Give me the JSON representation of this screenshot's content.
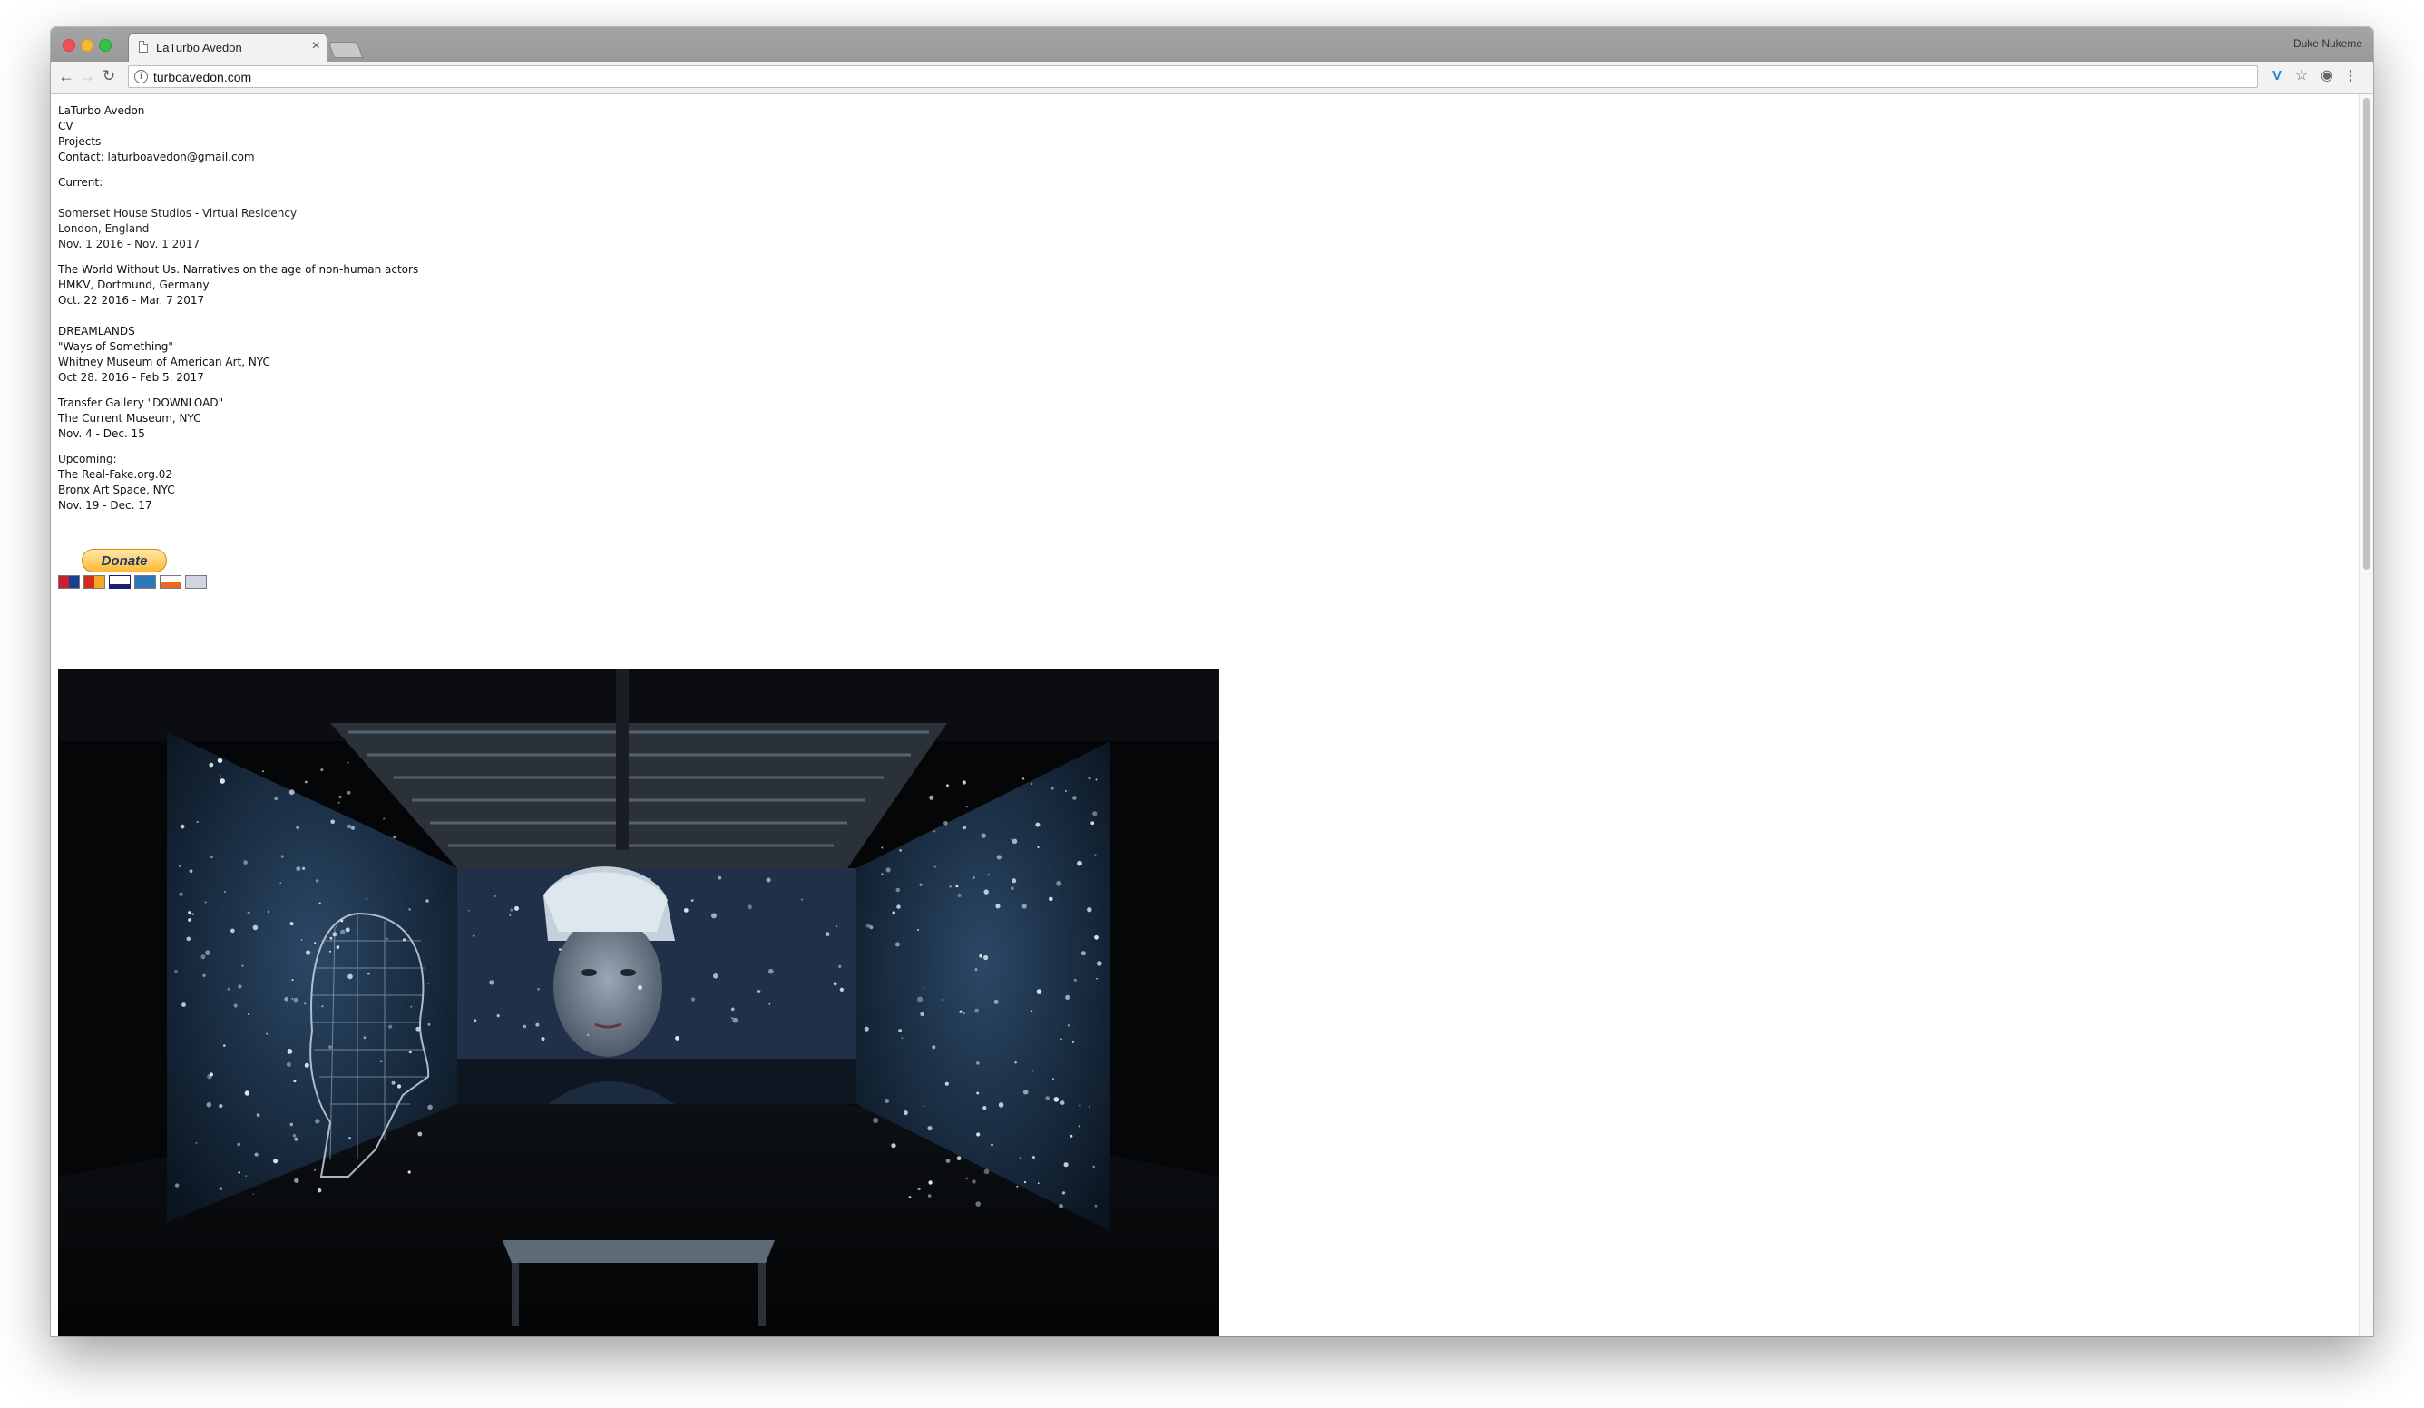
{
  "browser": {
    "tab_title": "LaTurbo Avedon",
    "tab_close": "×",
    "profile_name": "Duke Nukeme",
    "url": "turboavedon.com"
  },
  "page": {
    "site_title": "LaTurbo Avedon",
    "nav": {
      "cv": "CV",
      "projects": "Projects",
      "contact": "Contact: laturboavedon@gmail.com"
    },
    "current_heading": "Current:",
    "current": [
      [
        "Somerset House Studios - Virtual Residency",
        "London, England",
        "Nov. 1 2016 - Nov. 1 2017"
      ],
      [
        "The World Without Us. Narratives on the age of non-human actors",
        "HMKV, Dortmund, Germany",
        "Oct. 22 2016 - Mar. 7 2017"
      ],
      [
        "DREAMLANDS",
        "\"Ways of Something\"",
        "Whitney Museum of American Art, NYC",
        "Oct 28. 2016 - Feb 5. 2017"
      ],
      [
        "Transfer Gallery \"DOWNLOAD\"",
        "The Current Museum, NYC",
        "Nov. 4 - Dec. 15"
      ]
    ],
    "upcoming_heading": "Upcoming:",
    "upcoming": [
      [
        "The Real-Fake.org.02",
        "Bronx Art Space, NYC",
        "Nov. 19 - Dec. 17"
      ]
    ],
    "donate_label": "Donate"
  },
  "colors": {
    "window_chrome": "#a4a4a4",
    "toolbar": "#f2f2f2",
    "page_background": "#ffffff",
    "donate_button": "#fdb936"
  },
  "icons": {
    "back": "back-arrow-icon",
    "forward": "forward-arrow-icon",
    "reload": "reload-icon",
    "info": "info-icon",
    "bookmark": "star-icon",
    "menu": "kebab-menu-icon"
  }
}
